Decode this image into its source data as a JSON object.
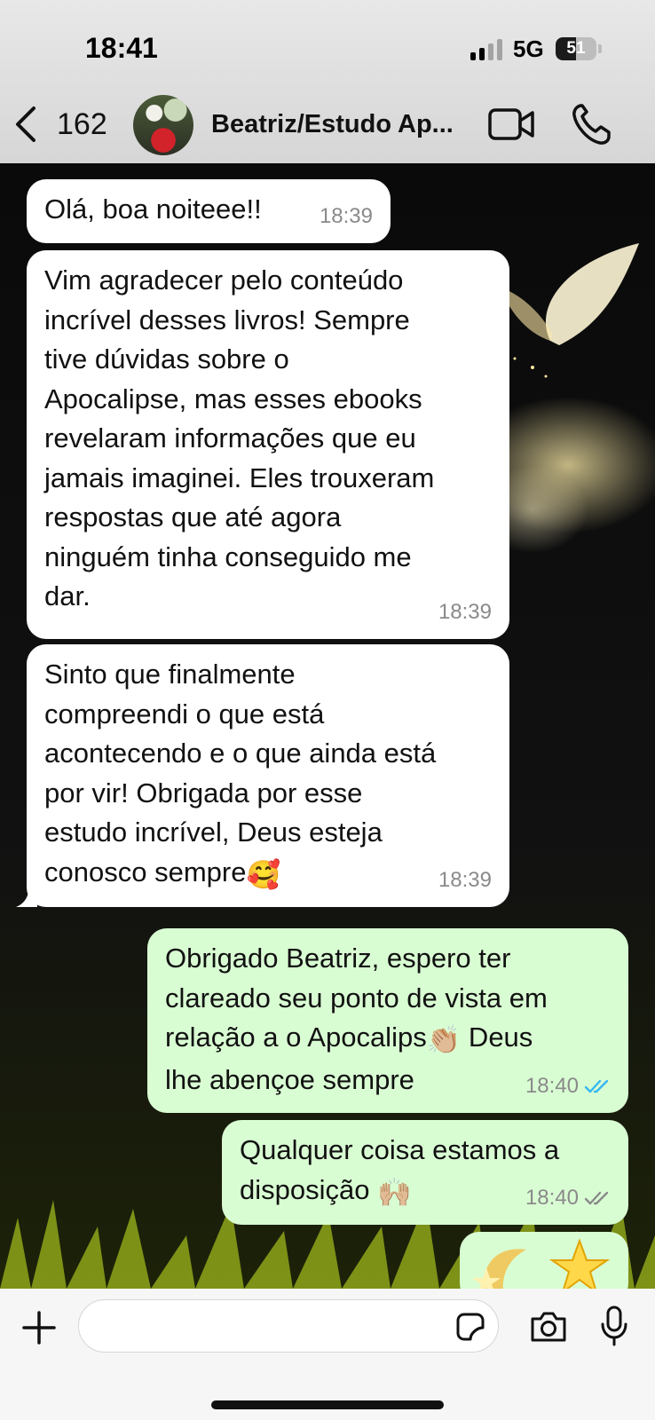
{
  "status_bar": {
    "time": "18:41",
    "network": "5G",
    "battery_level": "51",
    "battery_fraction": 0.51,
    "signal_bars_active": 2,
    "signal_bars_total": 4
  },
  "header": {
    "back_count": "162",
    "title": "Beatriz/Estudo Ap...",
    "icons": [
      "chevron-left-icon",
      "video-icon",
      "phone-icon"
    ]
  },
  "messages": [
    {
      "direction": "in",
      "text": "Olá, boa noiteee!!",
      "time": "18:39"
    },
    {
      "direction": "in",
      "lines": [
        "Vim agradecer pelo conteúdo",
        "incrível desses livros! Sempre",
        "tive dúvidas sobre o",
        "Apocalipse, mas esses ebooks",
        "revelaram informações que eu",
        "jamais imaginei. Eles trouxeram",
        "respostas que até agora",
        "ninguém tinha conseguido me",
        "dar."
      ],
      "time": "18:39"
    },
    {
      "direction": "in",
      "lines": [
        "Sinto que finalmente",
        "compreendi o que está",
        "acontecendo e o que ainda está",
        "por vir! Obrigada por esse",
        "estudo incrível, Deus esteja",
        "conosco sempre"
      ],
      "emoji": "🥰",
      "time": "18:39"
    },
    {
      "direction": "out",
      "lines": [
        "Obrigado Beatriz, espero ter",
        "clareado seu ponto de vista em",
        "relação a o Apocalips",
        " Deus",
        "lhe abençoe sempre"
      ],
      "emoji": "👏🏼",
      "time": "18:40",
      "read": true
    },
    {
      "direction": "out",
      "lines": [
        "Qualquer coisa estamos a",
        "disposição "
      ],
      "emoji": "🙌🏼",
      "time": "18:40",
      "read": false
    }
  ],
  "composer": {
    "placeholder": "",
    "icons": [
      "plus-icon",
      "sticker-icon",
      "camera-icon",
      "microphone-icon"
    ]
  },
  "colors": {
    "incoming_bubble": "#ffffff",
    "outgoing_bubble": "#d9fdd3",
    "read_tick": "#34b7f1",
    "unread_tick": "#8a8a8a"
  }
}
